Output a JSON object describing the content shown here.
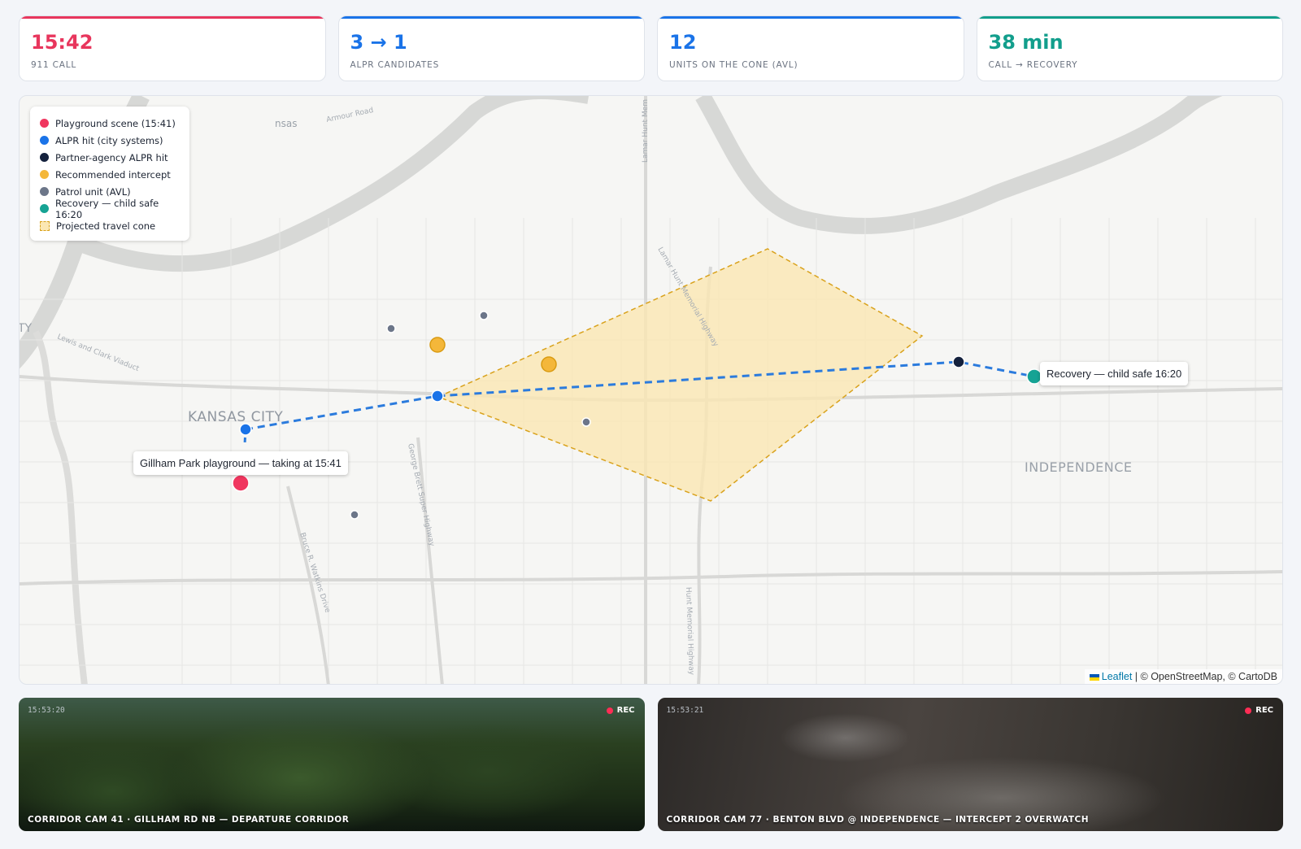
{
  "kpis": [
    {
      "value": "15:42",
      "label": "911 CALL",
      "color": "#e8365d"
    },
    {
      "value": "3 → 1",
      "label": "ALPR CANDIDATES",
      "color": "#1a73e8"
    },
    {
      "value": "12",
      "label": "UNITS ON THE CONE (AVL)",
      "color": "#1a73e8"
    },
    {
      "value": "38 min",
      "label": "CALL → RECOVERY",
      "color": "#129e8c"
    }
  ],
  "map": {
    "labels": {
      "kansas_city": "KANSAS CITY",
      "independence": "INDEPENDENCE",
      "ty": "TY",
      "nsas": "nsas",
      "armour_road": "Armour Road",
      "lewis_clark": "Lewis and Clark Viaduct",
      "lamar_hunt": "Lamar Hunt Memorial Highway",
      "lamar_hunt_top": "Lamar Hunt Mem",
      "lamar_hunt_low": "Hunt Memorial Highway",
      "george_brett": "George Brett Super Highway",
      "bruce_watkins": "Bruce R. Watkins Drive"
    },
    "legend": [
      {
        "label": "Playground scene (15:41)",
        "color": "#f0365f"
      },
      {
        "label": "ALPR hit (city systems)",
        "color": "#1a73e8"
      },
      {
        "label": "Partner-agency ALPR hit",
        "color": "#14213d"
      },
      {
        "label": "Recommended intercept",
        "color": "#f4b73a"
      },
      {
        "label": "Patrol unit (AVL)",
        "color": "#6c7689"
      },
      {
        "label": "Recovery — child safe 16:20",
        "color": "#16a394"
      },
      {
        "label": "Projected travel cone",
        "color": "#fbe7b3"
      }
    ],
    "tooltips": {
      "scene": "Gillham Park playground — taking at 15:41",
      "recovery": "Recovery — child safe 16:20"
    },
    "attribution": {
      "leaflet": "Leaflet",
      "rest": " | © OpenStreetMap, © CartoDB"
    }
  },
  "cameras": [
    {
      "timestamp": "15:53:20",
      "rec": "REC",
      "caption": "CORRIDOR CAM 41 · GILLHAM RD NB — DEPARTURE CORRIDOR"
    },
    {
      "timestamp": "15:53:21",
      "rec": "REC",
      "caption": "CORRIDOR CAM 77 · BENTON BLVD @ INDEPENDENCE — INTERCEPT 2 OVERWATCH"
    }
  ]
}
